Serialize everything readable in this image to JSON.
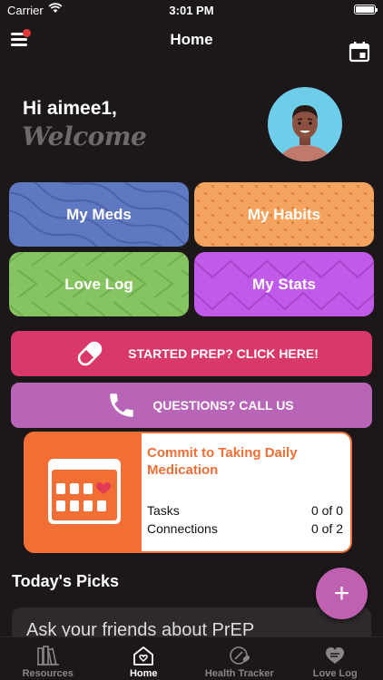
{
  "status_bar": {
    "carrier": "Carrier",
    "time": "3:01 PM"
  },
  "nav": {
    "title": "Home"
  },
  "header": {
    "greeting": "Hi aimee1,",
    "welcome": "Welcome"
  },
  "tiles": [
    {
      "label": "My Meds",
      "color": "#5f78c2"
    },
    {
      "label": "My Habits",
      "color": "#f4a45e"
    },
    {
      "label": "Love Log",
      "color": "#86c462"
    },
    {
      "label": "My Stats",
      "color": "#c15ae8"
    }
  ],
  "actions": {
    "prep_label": "STARTED PREP? CLICK HERE!",
    "call_label": "QUESTIONS? CALL US"
  },
  "commit_card": {
    "title": "Commit to Taking Daily Medication",
    "tasks_label": "Tasks",
    "tasks_value": "0 of 0",
    "connections_label": "Connections",
    "connections_value": "0 of 2"
  },
  "picks": {
    "title": "Today's Picks",
    "first_item": "Ask your friends about PrEP"
  },
  "fab": {
    "label": "+"
  },
  "tab_bar": {
    "tabs": [
      {
        "label": "Resources",
        "icon": "books-icon"
      },
      {
        "label": "Home",
        "icon": "house-heart-icon"
      },
      {
        "label": "Health Tracker",
        "icon": "pill-bottle-icon"
      },
      {
        "label": "Love Log",
        "icon": "heart-icon"
      }
    ],
    "active": "Home"
  },
  "colors": {
    "background": "#1c181a",
    "prep": "#d9386a",
    "call": "#b865b8",
    "commit": "#f16e34",
    "fab": "#c060b0"
  }
}
